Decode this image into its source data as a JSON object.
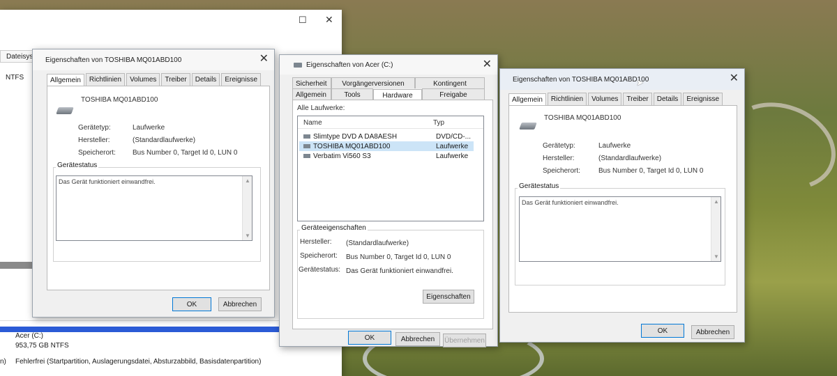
{
  "background_window": {
    "controls": {
      "maximize": "☐",
      "close": "✕"
    },
    "col_header": "Dateisyster",
    "fs_value": "NTFS",
    "volume_name": "Acer  (C:)",
    "volume_size": "953,75 GB NTFS",
    "volume_status": "Fehlerfrei (Startpartition, Auslagerungsdatei, Absturzabbild, Basisdatenpartition)",
    "edge_char": "n)"
  },
  "left_dialog": {
    "title": "Eigenschaften von TOSHIBA MQ01ABD100",
    "tabs": [
      "Allgemein",
      "Richtlinien",
      "Volumes",
      "Treiber",
      "Details",
      "Ereignisse"
    ],
    "device_name": "TOSHIBA MQ01ABD100",
    "labels": {
      "type": "Gerätetyp:",
      "maker": "Hersteller:",
      "location": "Speicherort:"
    },
    "values": {
      "type": "Laufwerke",
      "maker": "(Standardlaufwerke)",
      "location": "Bus Number 0, Target Id 0, LUN 0"
    },
    "status_group": "Gerätestatus",
    "status_text": "Das Gerät funktioniert einwandfrei.",
    "ok": "OK",
    "cancel": "Abbrechen"
  },
  "middle_dialog": {
    "title": "Eigenschaften von Acer (C:)",
    "tabs_row1": [
      "Sicherheit",
      "Vorgängerversionen",
      "Kontingent"
    ],
    "tabs_row2": [
      "Allgemein",
      "Tools",
      "Hardware",
      "Freigabe"
    ],
    "list_label": "Alle Laufwerke:",
    "col_name": "Name",
    "col_type": "Typ",
    "drives": [
      {
        "name": "Slimtype DVD A  DA8AESH",
        "type": "DVD/CD-..."
      },
      {
        "name": "TOSHIBA MQ01ABD100",
        "type": "Laufwerke"
      },
      {
        "name": "Verbatim Vi560 S3",
        "type": "Laufwerke"
      }
    ],
    "props_group": "Geräteeigenschaften",
    "labels": {
      "maker": "Hersteller:",
      "location": "Speicherort:",
      "status": "Gerätestatus:"
    },
    "values": {
      "maker": "(Standardlaufwerke)",
      "location": "Bus Number 0, Target Id 0, LUN 0",
      "status": "Das Gerät funktioniert einwandfrei."
    },
    "properties_button": "Eigenschaften",
    "ok": "OK",
    "cancel": "Abbrechen",
    "apply": "Übernehmen"
  },
  "right_dialog": {
    "title": "Eigenschaften von TOSHIBA MQ01ABD100",
    "tabs": [
      "Allgemein",
      "Richtlinien",
      "Volumes",
      "Treiber",
      "Details",
      "Ereignisse"
    ],
    "device_name": "TOSHIBA MQ01ABD100",
    "labels": {
      "type": "Gerätetyp:",
      "maker": "Hersteller:",
      "location": "Speicherort:"
    },
    "values": {
      "type": "Laufwerke",
      "maker": "(Standardlaufwerke)",
      "location": "Bus Number 0, Target Id 0, LUN 0"
    },
    "status_group": "Gerätestatus",
    "status_text": "Das Gerät funktioniert einwandfrei.",
    "ok": "OK",
    "cancel": "Abbrechen"
  }
}
